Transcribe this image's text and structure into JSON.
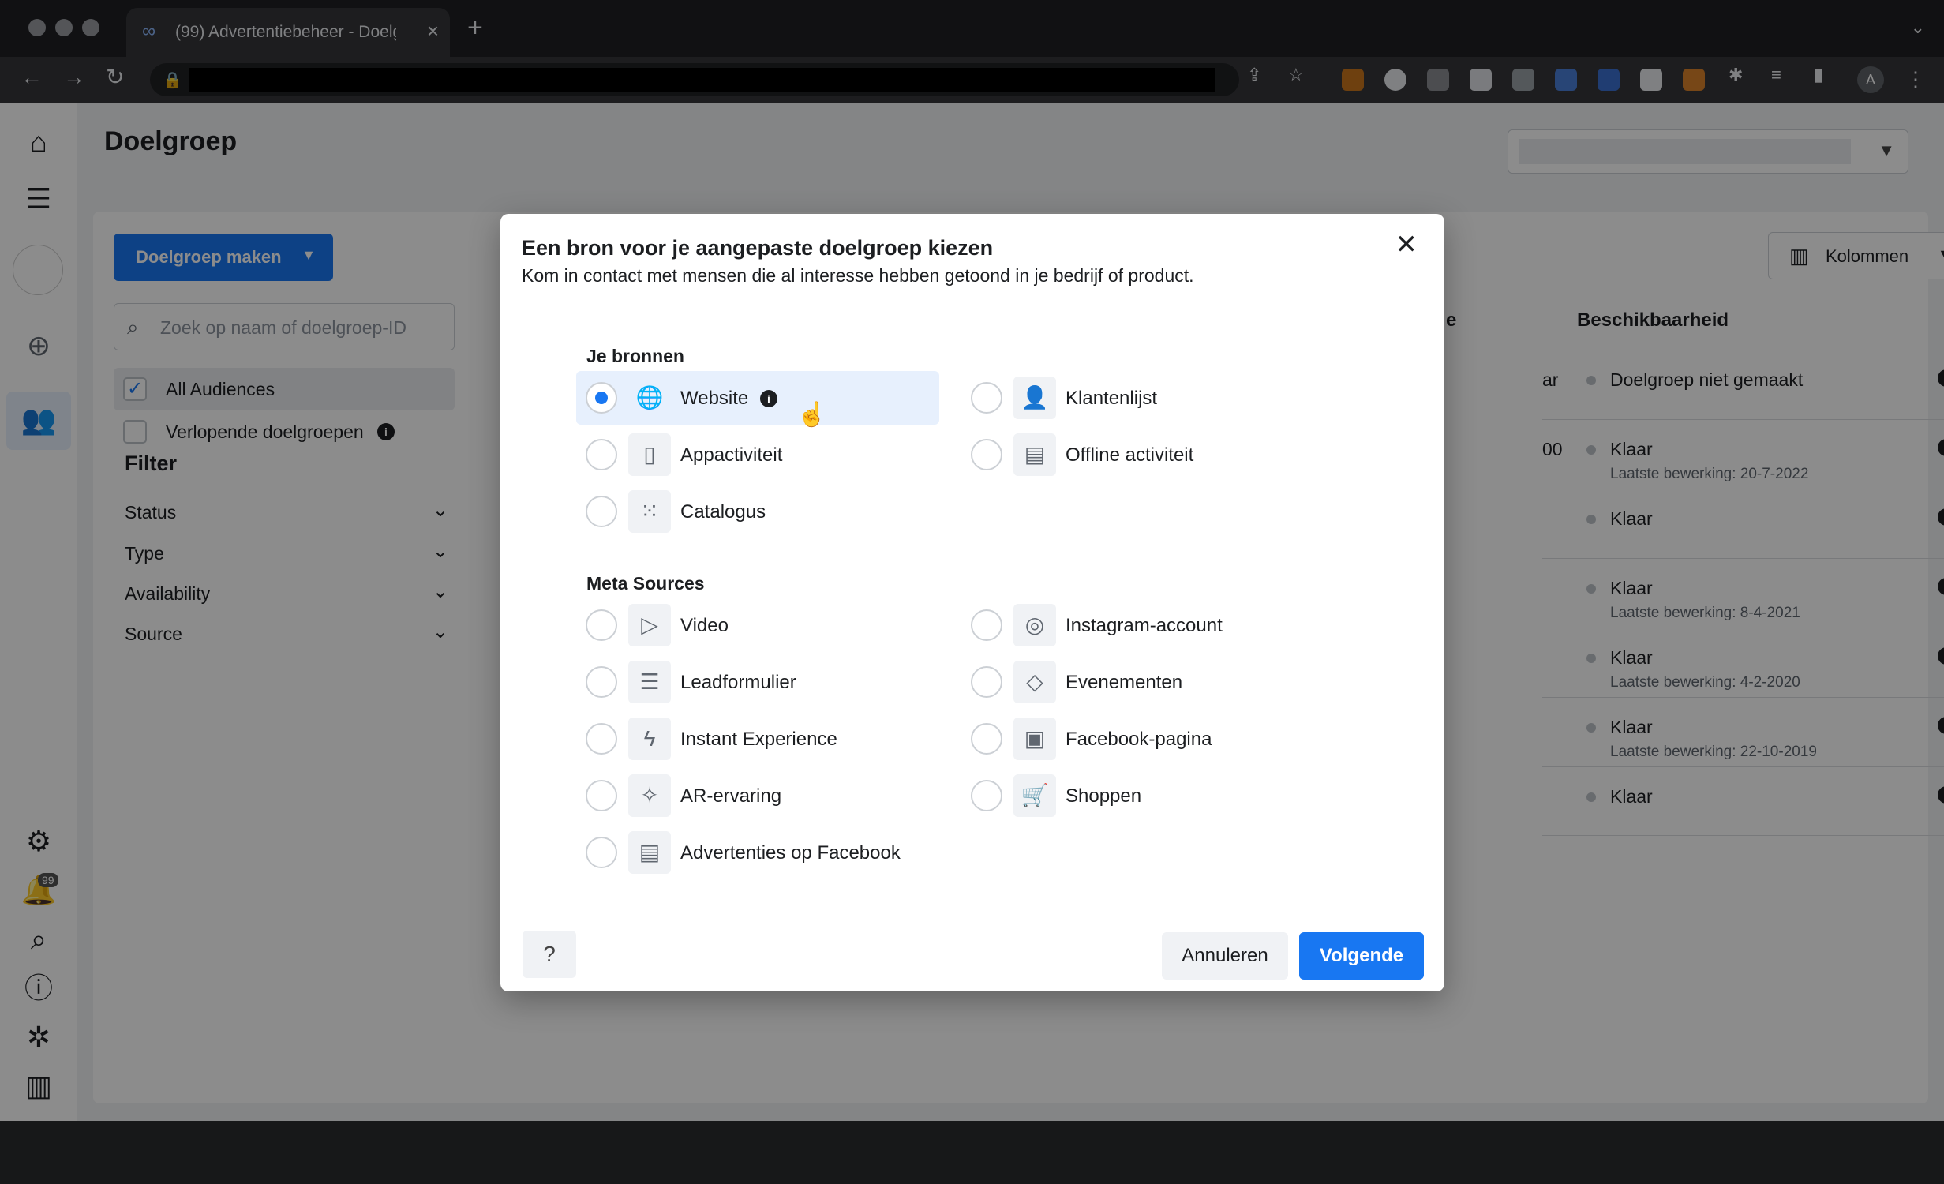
{
  "browser": {
    "tab_title": "(99) Advertentiebeheer - Doelg",
    "tab_icon": "meta-icon",
    "profile_initial": "A"
  },
  "app": {
    "page_title": "Doelgroep",
    "sidebar": {
      "notification_count": "99",
      "items": [
        "home-icon",
        "menu-icon",
        "account-avatar",
        "create-icon",
        "audiences-icon",
        "settings-icon",
        "notifications-icon",
        "search-icon",
        "help-icon",
        "bug-icon",
        "panel-icon"
      ]
    },
    "create_button_label": "Doelgroep maken",
    "search_placeholder": "Zoek op naam of doelgroep-ID",
    "audience_filters": [
      {
        "label": "All Audiences",
        "checked": true
      },
      {
        "label": "Verlopende doelgroepen",
        "checked": false
      }
    ],
    "filter": {
      "title": "Filter",
      "items": [
        "Status",
        "Type",
        "Availability",
        "Source"
      ]
    },
    "columns_button_label": "Kolommen",
    "table": {
      "column_header": "Beschikbaarheid",
      "column_header_fragment": "e",
      "rows": [
        {
          "frag": "ar",
          "status": "Doelgroep niet gemaakt",
          "sub": ""
        },
        {
          "frag": "00",
          "status": "Klaar",
          "sub": "Laatste bewerking: 20-7-2022"
        },
        {
          "frag": "",
          "status": "Klaar",
          "sub": ""
        },
        {
          "frag": "",
          "status": "Klaar",
          "sub": "Laatste bewerking: 8-4-2021"
        },
        {
          "frag": "",
          "status": "Klaar",
          "sub": "Laatste bewerking: 4-2-2020"
        },
        {
          "frag": "",
          "status": "Klaar",
          "sub": "Laatste bewerking: 22-10-2019"
        },
        {
          "frag": "",
          "status": "Klaar",
          "sub": ""
        }
      ]
    }
  },
  "modal": {
    "title": "Een bron voor je aangepaste doelgroep kiezen",
    "subtitle": "Kom in contact met mensen die al interesse hebben getoond in je bedrijf of product.",
    "sections": {
      "your_sources": {
        "title": "Je bronnen",
        "options": [
          {
            "label": "Website",
            "icon": "globe-icon",
            "selected": true
          },
          {
            "label": "Klantenlijst",
            "icon": "customer-list-icon",
            "selected": false
          },
          {
            "label": "Appactiviteit",
            "icon": "mobile-icon",
            "selected": false
          },
          {
            "label": "Offline activiteit",
            "icon": "store-icon",
            "selected": false
          },
          {
            "label": "Catalogus",
            "icon": "grid-icon",
            "selected": false
          }
        ]
      },
      "meta_sources": {
        "title": "Meta Sources",
        "options": [
          {
            "label": "Video",
            "icon": "play-icon"
          },
          {
            "label": "Instagram-account",
            "icon": "instagram-icon"
          },
          {
            "label": "Leadformulier",
            "icon": "list-icon"
          },
          {
            "label": "Evenementen",
            "icon": "ticket-icon"
          },
          {
            "label": "Instant Experience",
            "icon": "lightning-icon"
          },
          {
            "label": "Facebook-pagina",
            "icon": "page-icon"
          },
          {
            "label": "AR-ervaring",
            "icon": "sparkle-icon"
          },
          {
            "label": "Shoppen",
            "icon": "cart-icon"
          },
          {
            "label": "Advertenties op Facebook",
            "icon": "shop-icon"
          }
        ]
      }
    },
    "cancel_label": "Annuleren",
    "next_label": "Volgende"
  }
}
